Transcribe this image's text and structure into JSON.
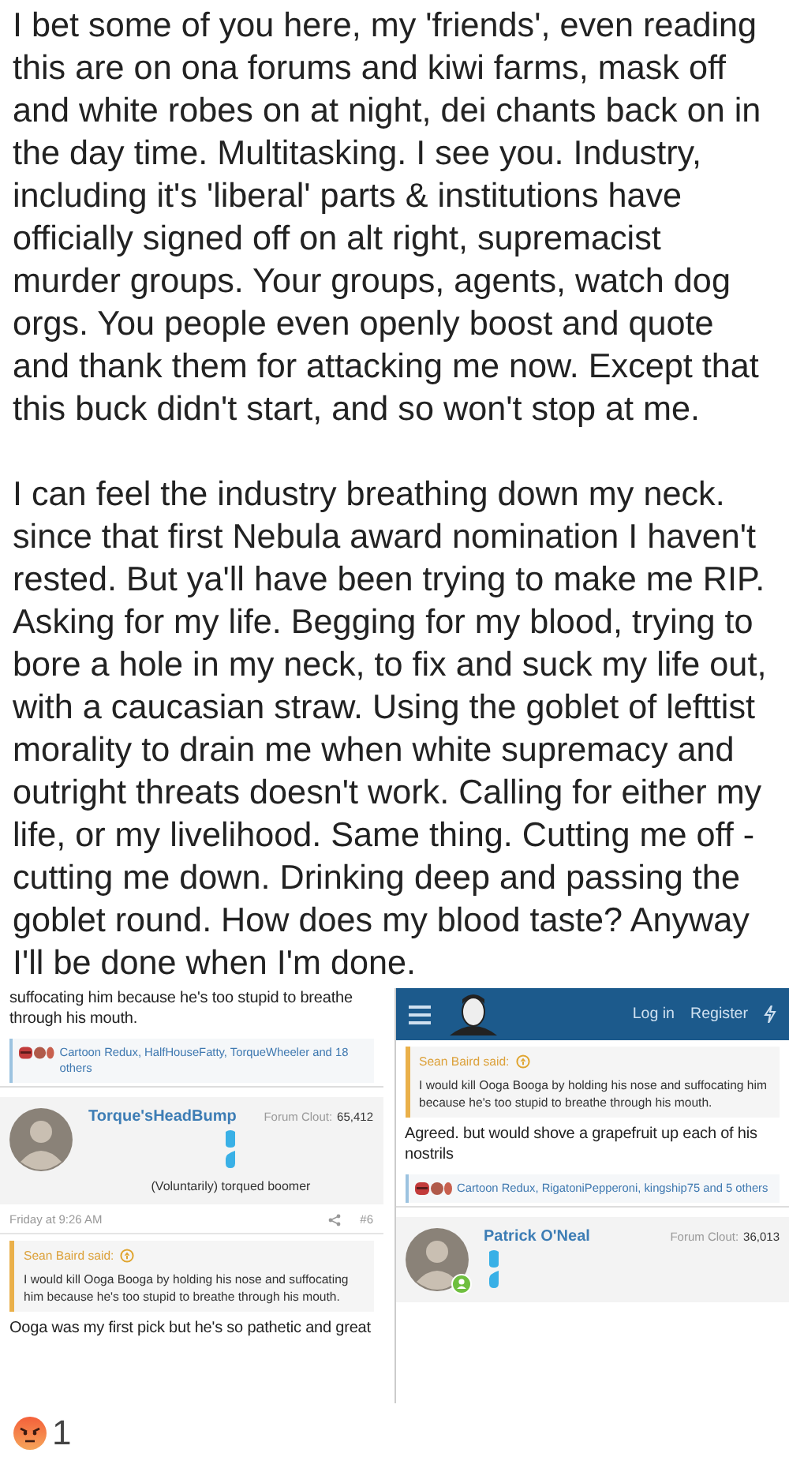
{
  "post": {
    "paragraphs": [
      "I bet some of you here, my 'friends', even reading this are on ona forums and kiwi farms, mask off and white robes on at night, dei chants back on in the day time. Multitasking. I see you. Industry, including it's 'liberal' parts & institutions have officially signed off on alt right, supremacist murder groups. Your groups, agents, watch dog orgs. You people even openly boost and quote and thank them for attacking me now. Except that this buck didn't start, and so won't stop at me.",
      "I can feel the industry breathing down my neck. since that first Nebula award nomination I haven't rested. But ya'll have been trying to make me RIP. Asking for my life. Begging for my blood, trying to bore a hole in my neck, to fix and suck my life out, with a caucasian straw. Using the goblet of lefttist morality to drain me when white supremacy and outright threats doesn't work. Calling for either my life, or my livelihood. Same thing. Cutting me off - cutting me down. Drinking deep and passing the goblet round. How does my blood taste? Anyway I'll be done when I'm done."
    ]
  },
  "screenshots": [
    {
      "blocks": [
        {
          "kind": "text",
          "text": "suffocating him because he's too stupid to breathe through his mouth."
        },
        {
          "kind": "likes",
          "text": "Cartoon Redux, HalfHouseFatty, TorqueWheeler and 18 others"
        },
        {
          "kind": "user",
          "name": "Torque'sHeadBump",
          "clout_label": "Forum Clout:",
          "clout": "65,412",
          "title": "(Voluntarily) torqued boomer",
          "online": false
        },
        {
          "kind": "meta",
          "date": "Friday at 9:26 AM",
          "number": "#6"
        },
        {
          "kind": "quote",
          "author": "Sean Baird said:",
          "text": "I would kill Ooga Booga by holding his nose and suffocating him because he's too stupid to breathe through his mouth."
        },
        {
          "kind": "text",
          "text": "Ooga was my first pick but he's so pathetic and great"
        }
      ]
    },
    {
      "blocks": [
        {
          "kind": "header",
          "login": "Log in",
          "register": "Register"
        },
        {
          "kind": "quote",
          "author": "Sean Baird said:",
          "text": "I would kill Ooga Booga by holding his nose and suffocating him because he's too stupid to breathe through his mouth."
        },
        {
          "kind": "text",
          "text": "Agreed. but would shove a grapefruit up each of his nostrils"
        },
        {
          "kind": "likes",
          "text": "Cartoon Redux, RigatoniPepperoni, kingship75 and 5 others"
        },
        {
          "kind": "user",
          "name": "Patrick O'Neal",
          "clout_label": "Forum Clout:",
          "clout": "36,013",
          "online": true
        }
      ]
    }
  ],
  "reactions": [
    {
      "count": "1"
    }
  ]
}
